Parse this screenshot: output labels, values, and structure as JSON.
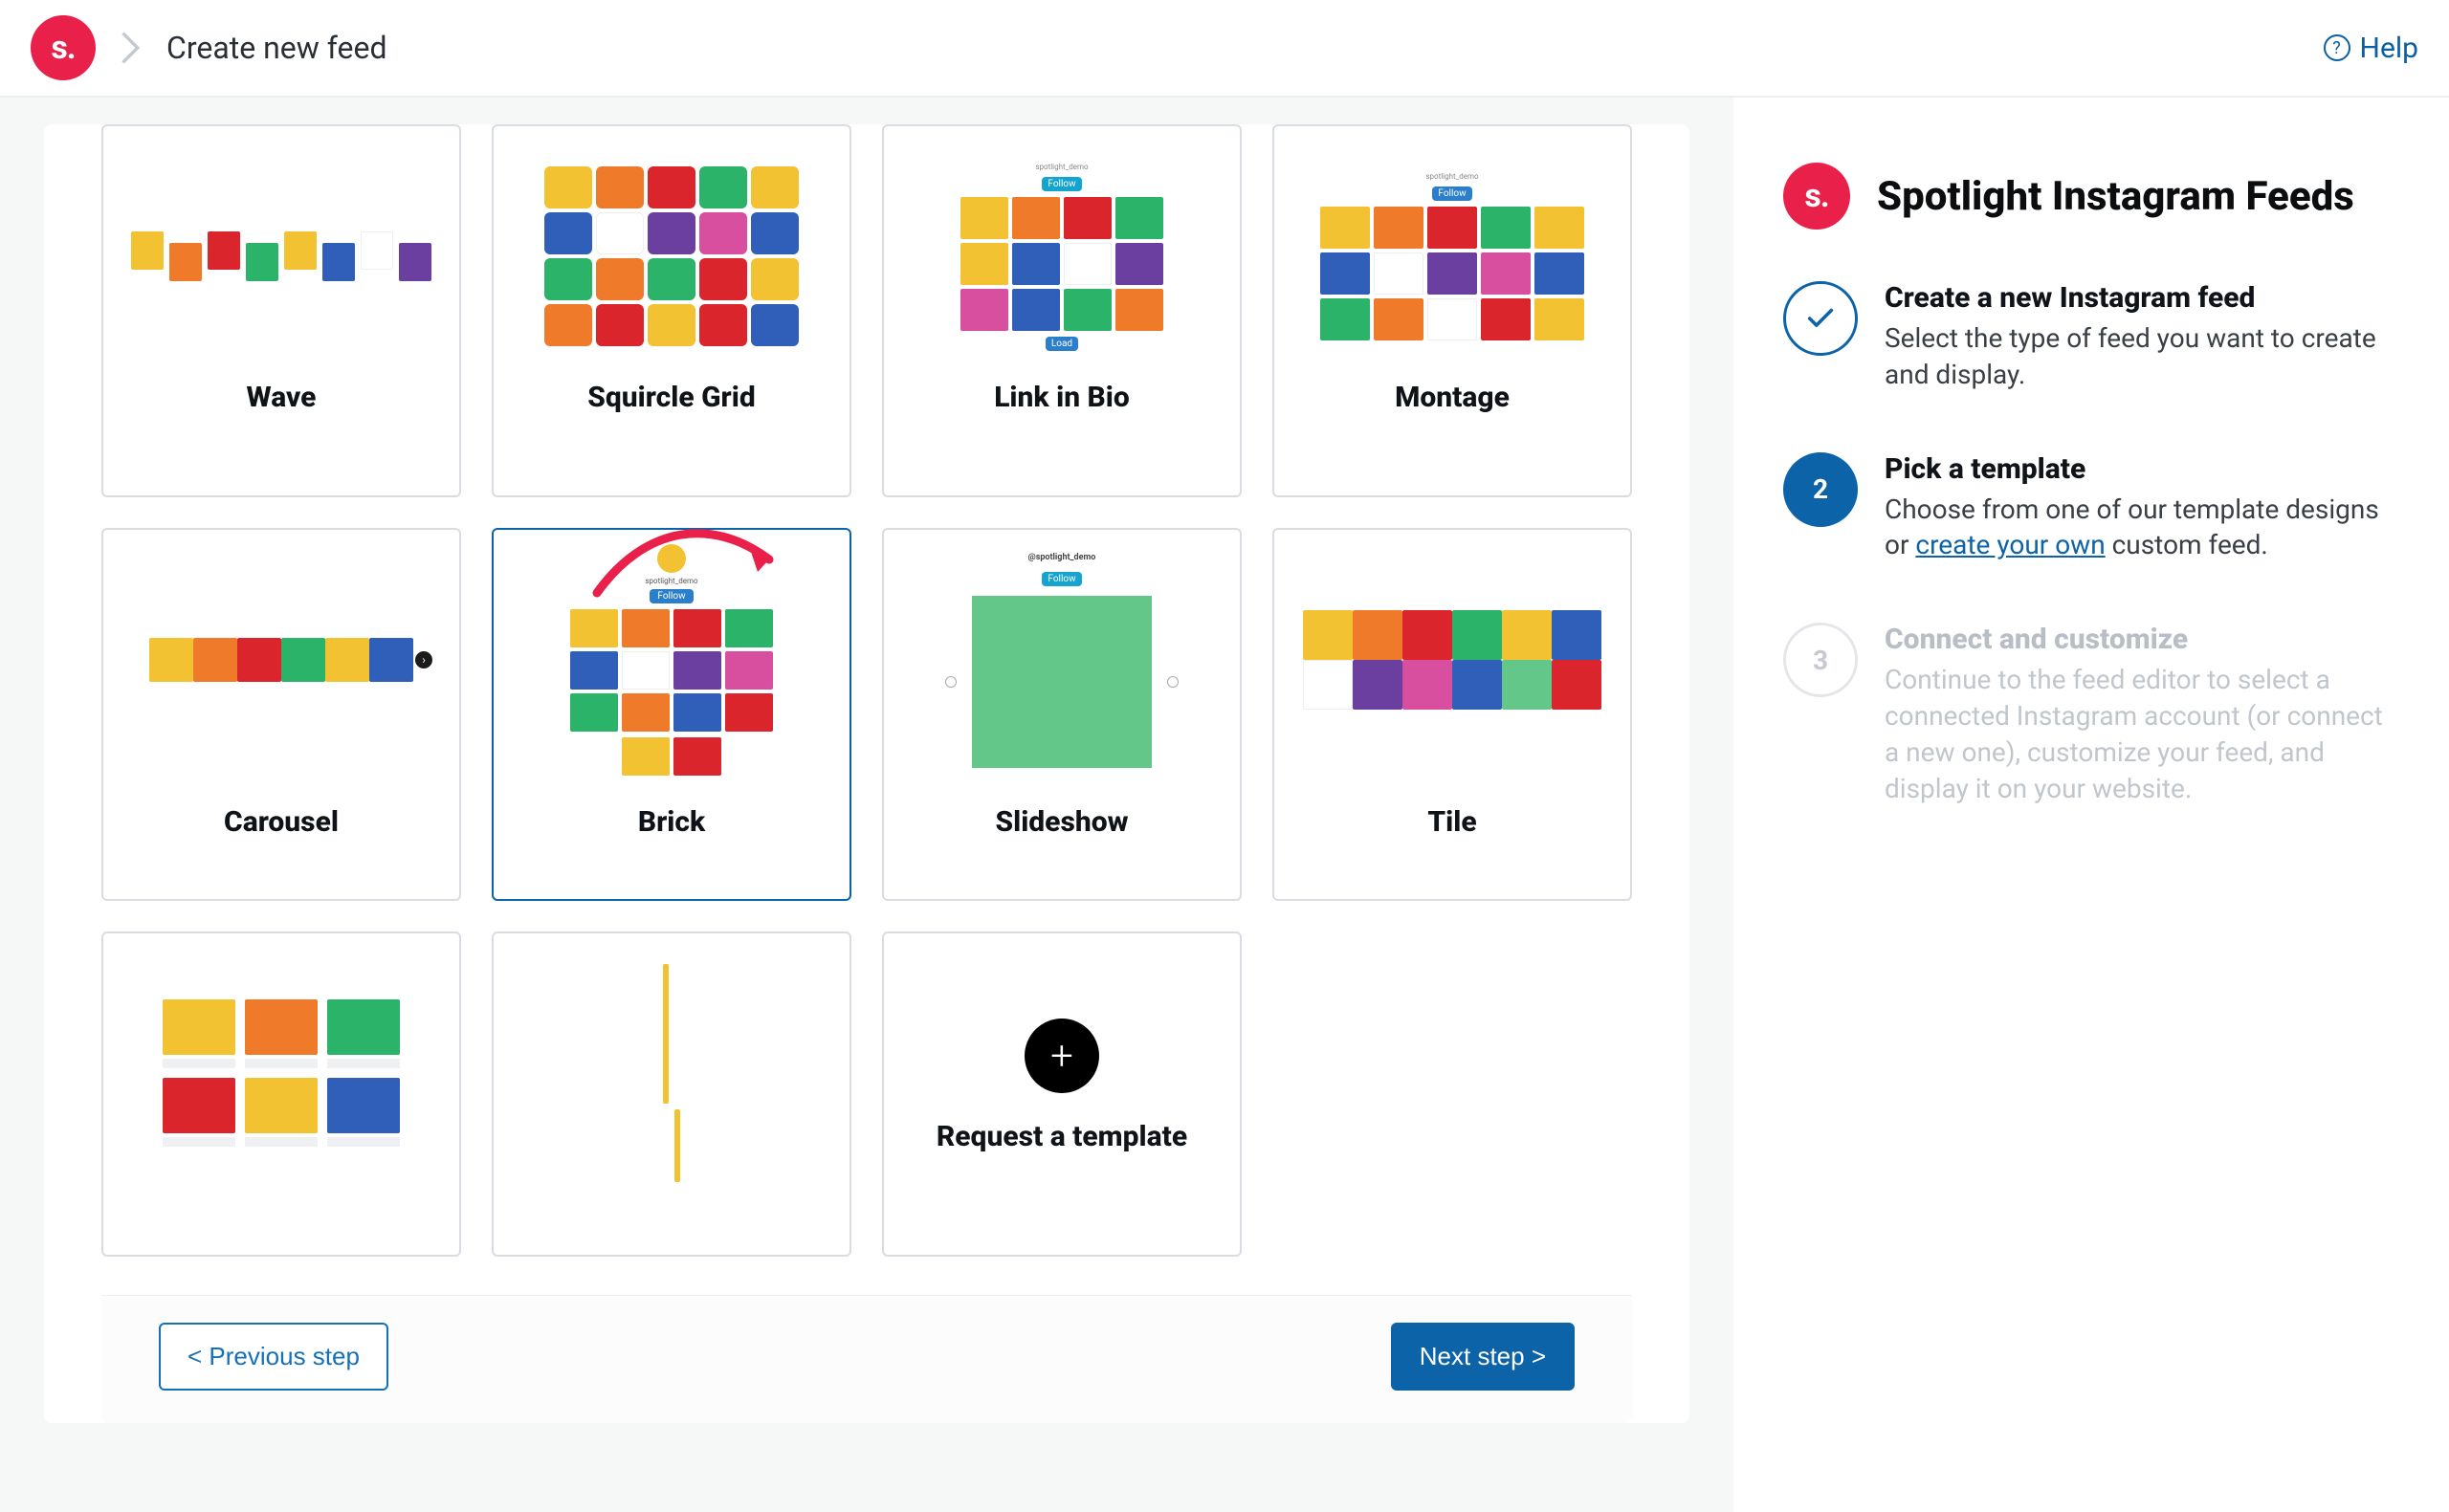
{
  "header": {
    "logo_text": "s.",
    "breadcrumb": "Create new feed",
    "help_label": "Help"
  },
  "templates": {
    "wave": "Wave",
    "squircle": "Squircle Grid",
    "linkinbio": "Link in Bio",
    "montage": "Montage",
    "carousel": "Carousel",
    "brick": "Brick",
    "slideshow": "Slideshow",
    "tile": "Tile",
    "request": "Request a template"
  },
  "selected_template": "brick",
  "footer": {
    "prev": "< Previous step",
    "next": "Next step >"
  },
  "sidebar": {
    "brand_logo_text": "s.",
    "title": "Spotlight Instagram Feeds",
    "steps": [
      {
        "title": "Create a new Instagram feed",
        "body": "Select the type of feed you want to create and display."
      },
      {
        "number": "2",
        "title": "Pick a template",
        "body_pre": "Choose from one of our template designs or ",
        "body_link": "create your own",
        "body_post": " custom feed."
      },
      {
        "number": "3",
        "title": "Connect and customize",
        "body": "Continue to the feed editor to select a connected Instagram account (or connect a new one), customize your feed, and display it on your website."
      }
    ]
  }
}
